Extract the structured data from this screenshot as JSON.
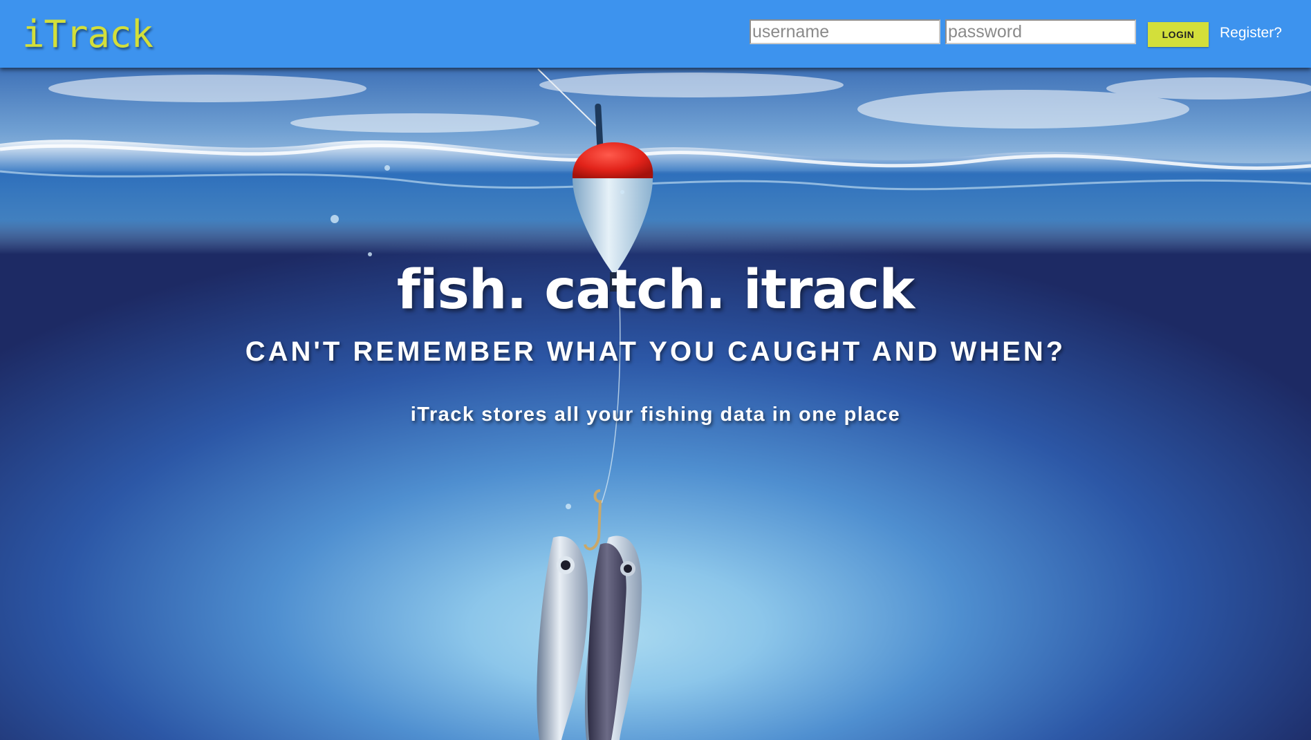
{
  "header": {
    "logo_text": "iTrack",
    "username_placeholder": "username",
    "password_placeholder": "password",
    "login_label": "LOGIN",
    "register_label": "Register?"
  },
  "hero": {
    "headline": "fish. catch. itrack",
    "subheadline": "CAN'T REMEMBER WHAT YOU CAUGHT AND WHEN?",
    "tagline": "iTrack stores all your fishing data in one place"
  },
  "colors": {
    "header_bg": "#3d93ee",
    "logo_accent": "#d3df3a",
    "login_button_bg": "#d3df3a",
    "water_deep": "#1e2c66",
    "water_light": "#a6d6ee",
    "bobber_red": "#e2231a"
  }
}
